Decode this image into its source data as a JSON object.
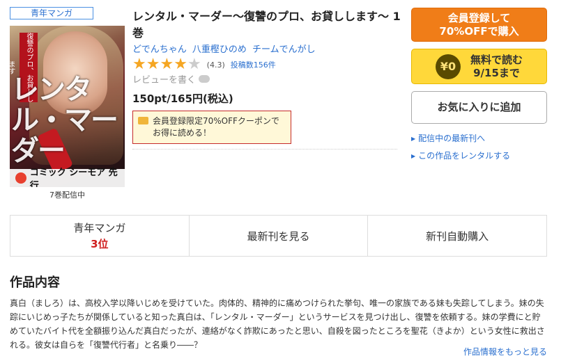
{
  "genre_tag": "青年マンガ",
  "cover": {
    "vertical_text": "復讐のプロ、お貸しします",
    "big_title": "レンタル・マーダー",
    "badge": "コミック シーモア 先行"
  },
  "cover_caption": "7巻配信中",
  "title": "レンタル・マーダー～復讐のプロ、お貸しします～ 1巻",
  "authors": [
    "どでんちゃん",
    "八重樫ひのめ",
    "チームでんがし"
  ],
  "rating": {
    "stars_filled": 4,
    "stars_total": 5,
    "score": "(4.3)",
    "reviews": "投稿数156件"
  },
  "write_review": "レビューを書く",
  "price": "150pt/165円(税込)",
  "coupon": {
    "line1": "会員登録限定70%OFFクーポンで",
    "line2": "お得に読める！"
  },
  "buttons": {
    "register_line1": "会員登録して",
    "register_line2": "70%OFFで購入",
    "free_icon": "¥0",
    "free_line1": "無料で読む",
    "free_line2": "9/15まで",
    "favorite": "お気に入りに追加"
  },
  "side_links": {
    "latest": "配信中の最新刊へ",
    "rental": "この作品をレンタルする"
  },
  "tabs": {
    "genre_label": "青年マンガ",
    "genre_rank": "3位",
    "latest": "最新刊を見る",
    "auto_buy": "新刊自動購入"
  },
  "section_title": "作品内容",
  "description": "真白（ましろ）は、高校入学以降いじめを受けていた。肉体的、精神的に痛めつけられた挙句、唯一の家族である妹も失踪してしまう。妹の失踪にいじめっ子たちが関係していると知った真白は、「レンタル・マーダー」というサービスを見つけ出し、復讐を依頼する。妹の学費にと貯めていたバイト代を全額振り込んだ真白だったが、連絡がなく詐欺にあったと思い、自殺を図ったところを聖花（きよか）という女性に救出される。彼女は自らを「復讐代行者」と名乗り――？",
  "more_link": "作品情報をもっと見る",
  "colors": {
    "accent_orange": "#f07d18",
    "accent_yellow": "#ffd83a",
    "link_blue": "#2a6fcf",
    "rank_red": "#d01f1f"
  }
}
